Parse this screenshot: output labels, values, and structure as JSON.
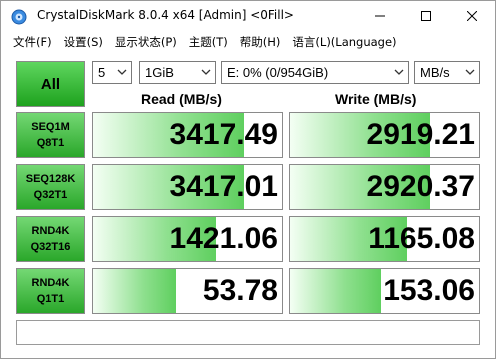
{
  "window": {
    "title": "CrystalDiskMark 8.0.4 x64 [Admin] <0Fill>",
    "icons": {
      "app": "crystaldiskmark-icon",
      "minimize": "minimize-icon",
      "maximize": "maximize-icon",
      "close": "close-icon"
    }
  },
  "menu": [
    {
      "label": "文件(F)"
    },
    {
      "label": "设置(S)"
    },
    {
      "label": "显示状态(P)"
    },
    {
      "label": "主题(T)"
    },
    {
      "label": "帮助(H)"
    },
    {
      "label": "语言(L)(Language)"
    }
  ],
  "controls": {
    "all_label": "All",
    "count_value": "5",
    "size_value": "1GiB",
    "drive_value": "E: 0% (0/954GiB)",
    "unit_value": "MB/s"
  },
  "headers": {
    "read": "Read (MB/s)",
    "write": "Write (MB/s)"
  },
  "tests": [
    {
      "line1": "SEQ1M",
      "line2": "Q8T1",
      "read": "3417.49",
      "write": "2919.21",
      "read_fill": 0.8,
      "write_fill": 0.74
    },
    {
      "line1": "SEQ128K",
      "line2": "Q32T1",
      "read": "3417.01",
      "write": "2920.37",
      "read_fill": 0.8,
      "write_fill": 0.74
    },
    {
      "line1": "RND4K",
      "line2": "Q32T16",
      "read": "1421.06",
      "write": "1165.08",
      "read_fill": 0.65,
      "write_fill": 0.62
    },
    {
      "line1": "RND4K",
      "line2": "Q1T1",
      "read": "53.78",
      "write": "153.06",
      "read_fill": 0.44,
      "write_fill": 0.48
    }
  ],
  "comment": "",
  "colors": {
    "accent_green": "#1ea21e",
    "bar_green": "#5fcf5f"
  }
}
